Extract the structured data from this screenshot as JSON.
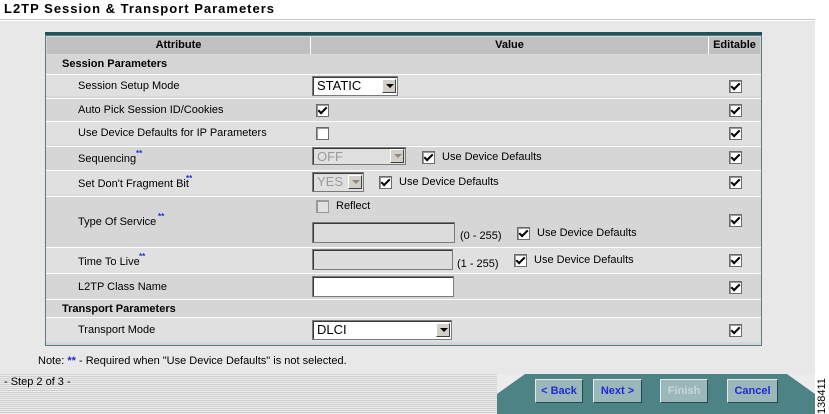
{
  "page": {
    "title": "L2TP Session & Transport Parameters"
  },
  "table": {
    "headers": [
      "Attribute",
      "Value",
      "Editable"
    ],
    "sections": {
      "session": "Session Parameters",
      "transport": "Transport Parameters"
    },
    "rows": {
      "setup_mode": {
        "label": "Session Setup Mode",
        "value": "STATIC",
        "editable": true
      },
      "auto_pick": {
        "label": "Auto Pick Session ID/Cookies",
        "checked": true,
        "editable": true
      },
      "device_defaults_ip": {
        "label": "Use Device Defaults for IP Parameters",
        "checked": false,
        "editable": true
      },
      "sequencing": {
        "label": "Sequencing",
        "value": "OFF",
        "use_defaults_label": "Use Device Defaults",
        "use_defaults": true,
        "editable": true
      },
      "dont_fragment": {
        "label": "Set Don't Fragment Bit",
        "value": "YES",
        "use_defaults_label": "Use Device Defaults",
        "use_defaults": true,
        "editable": true
      },
      "tos": {
        "label": "Type Of Service",
        "reflect_label": "Reflect",
        "reflect": false,
        "range": "(0 - 255)",
        "use_defaults_label": "Use Device Defaults",
        "use_defaults": true,
        "editable": true
      },
      "ttl": {
        "label": "Time To Live",
        "range": "(1 - 255)",
        "use_defaults_label": "Use Device Defaults",
        "use_defaults": true,
        "editable": true
      },
      "class_name": {
        "label": "L2TP Class Name",
        "value": "",
        "editable": true
      },
      "transport_mode": {
        "label": "Transport Mode",
        "value": "DLCI",
        "editable": true
      }
    },
    "required_marker": "**"
  },
  "note": {
    "prefix": "Note: ",
    "stars": "**",
    "text": " - Required when \"Use Device Defaults\" is not selected."
  },
  "footer": {
    "step": "- Step 2 of 3 -",
    "buttons": {
      "back": "< Back",
      "next": "Next >",
      "finish": "Finish",
      "cancel": "Cancel"
    },
    "figure_id": "138411"
  },
  "colors": {
    "grid_teal": "#4e7f82",
    "link_blue": "#1e2bd8",
    "wizard_bar": "#4e8386"
  }
}
